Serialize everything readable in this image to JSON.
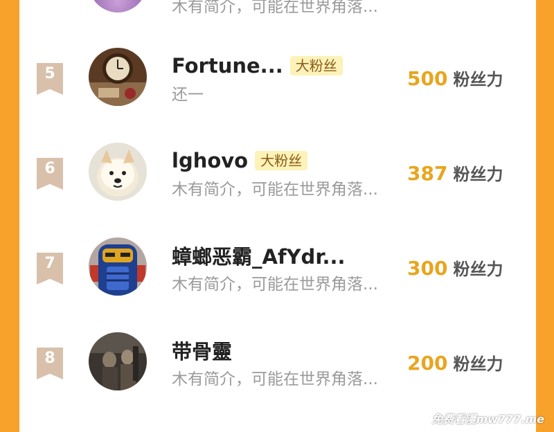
{
  "partial_top": {
    "bio": "木有简介，可能在世界角落..."
  },
  "rows": [
    {
      "rank": "5",
      "name": "Fortune...",
      "badge": "大粉丝",
      "bio": "还一",
      "fans_value": "500",
      "fans_label": "粉丝力",
      "avatar_icon": "clock-avatar-icon"
    },
    {
      "rank": "6",
      "name": "lghovo",
      "badge": "大粉丝",
      "bio": "木有简介，可能在世界角落...",
      "fans_value": "387",
      "fans_label": "粉丝力",
      "avatar_icon": "dog-avatar-icon"
    },
    {
      "rank": "7",
      "name": "蟑螂恶霸_AfYdr...",
      "badge": "",
      "bio": "木有简介，可能在世界角落...",
      "fans_value": "300",
      "fans_label": "粉丝力",
      "avatar_icon": "robot-avatar-icon"
    },
    {
      "rank": "8",
      "name": "带骨靈",
      "badge": "",
      "bio": "木有简介，可能在世界角落...",
      "fans_value": "200",
      "fans_label": "粉丝力",
      "avatar_icon": "photo-avatar-icon"
    }
  ],
  "watermark": "免费看漫mw777.me",
  "colors": {
    "frame": "#f7a12a",
    "rank_bg": "#d8c0ab",
    "fans_value": "#e8a51e",
    "badge_bg": "#fdf2b8"
  }
}
